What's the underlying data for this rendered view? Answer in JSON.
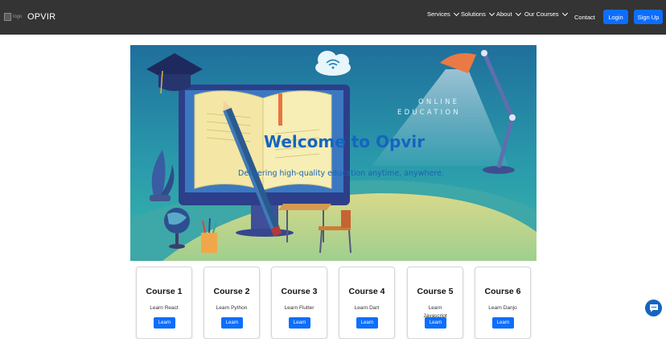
{
  "navbar": {
    "logo_alt": "logo",
    "brand": "OPVIR",
    "items": [
      {
        "label": "Services",
        "dropdown": true
      },
      {
        "label": "Solutions",
        "dropdown": true
      },
      {
        "label": "About",
        "dropdown": true
      },
      {
        "label": "Our Courses",
        "dropdown": true
      },
      {
        "label": "Contact",
        "dropdown": false
      }
    ],
    "login_label": "Login",
    "signup_label": "Sign Up"
  },
  "hero": {
    "overline_line1": "ONLINE",
    "overline_line2": "EDUCATION",
    "title": "Welcome to Opvir",
    "tagline": "Delivering high-quality education anytime, anywhere."
  },
  "courses": [
    {
      "title": "Course 1",
      "description": "Learn React",
      "button": "Learn"
    },
    {
      "title": "Course 2",
      "description": "Learn Python",
      "button": "Learn"
    },
    {
      "title": "Course 3",
      "description": "Learn Flutter",
      "button": "Learn"
    },
    {
      "title": "Course 4",
      "description": "Learn Dart",
      "button": "Learn"
    },
    {
      "title": "Course 5",
      "description": "Learn Javascript",
      "button": "Learn"
    },
    {
      "title": "Course 6",
      "description": "Learn Danjo",
      "button": "Learn"
    }
  ],
  "chat": {
    "icon": "chat-icon"
  },
  "colors": {
    "navbar_bg": "#343434",
    "primary": "#0d6efd",
    "hero_title": "#1565c0"
  }
}
